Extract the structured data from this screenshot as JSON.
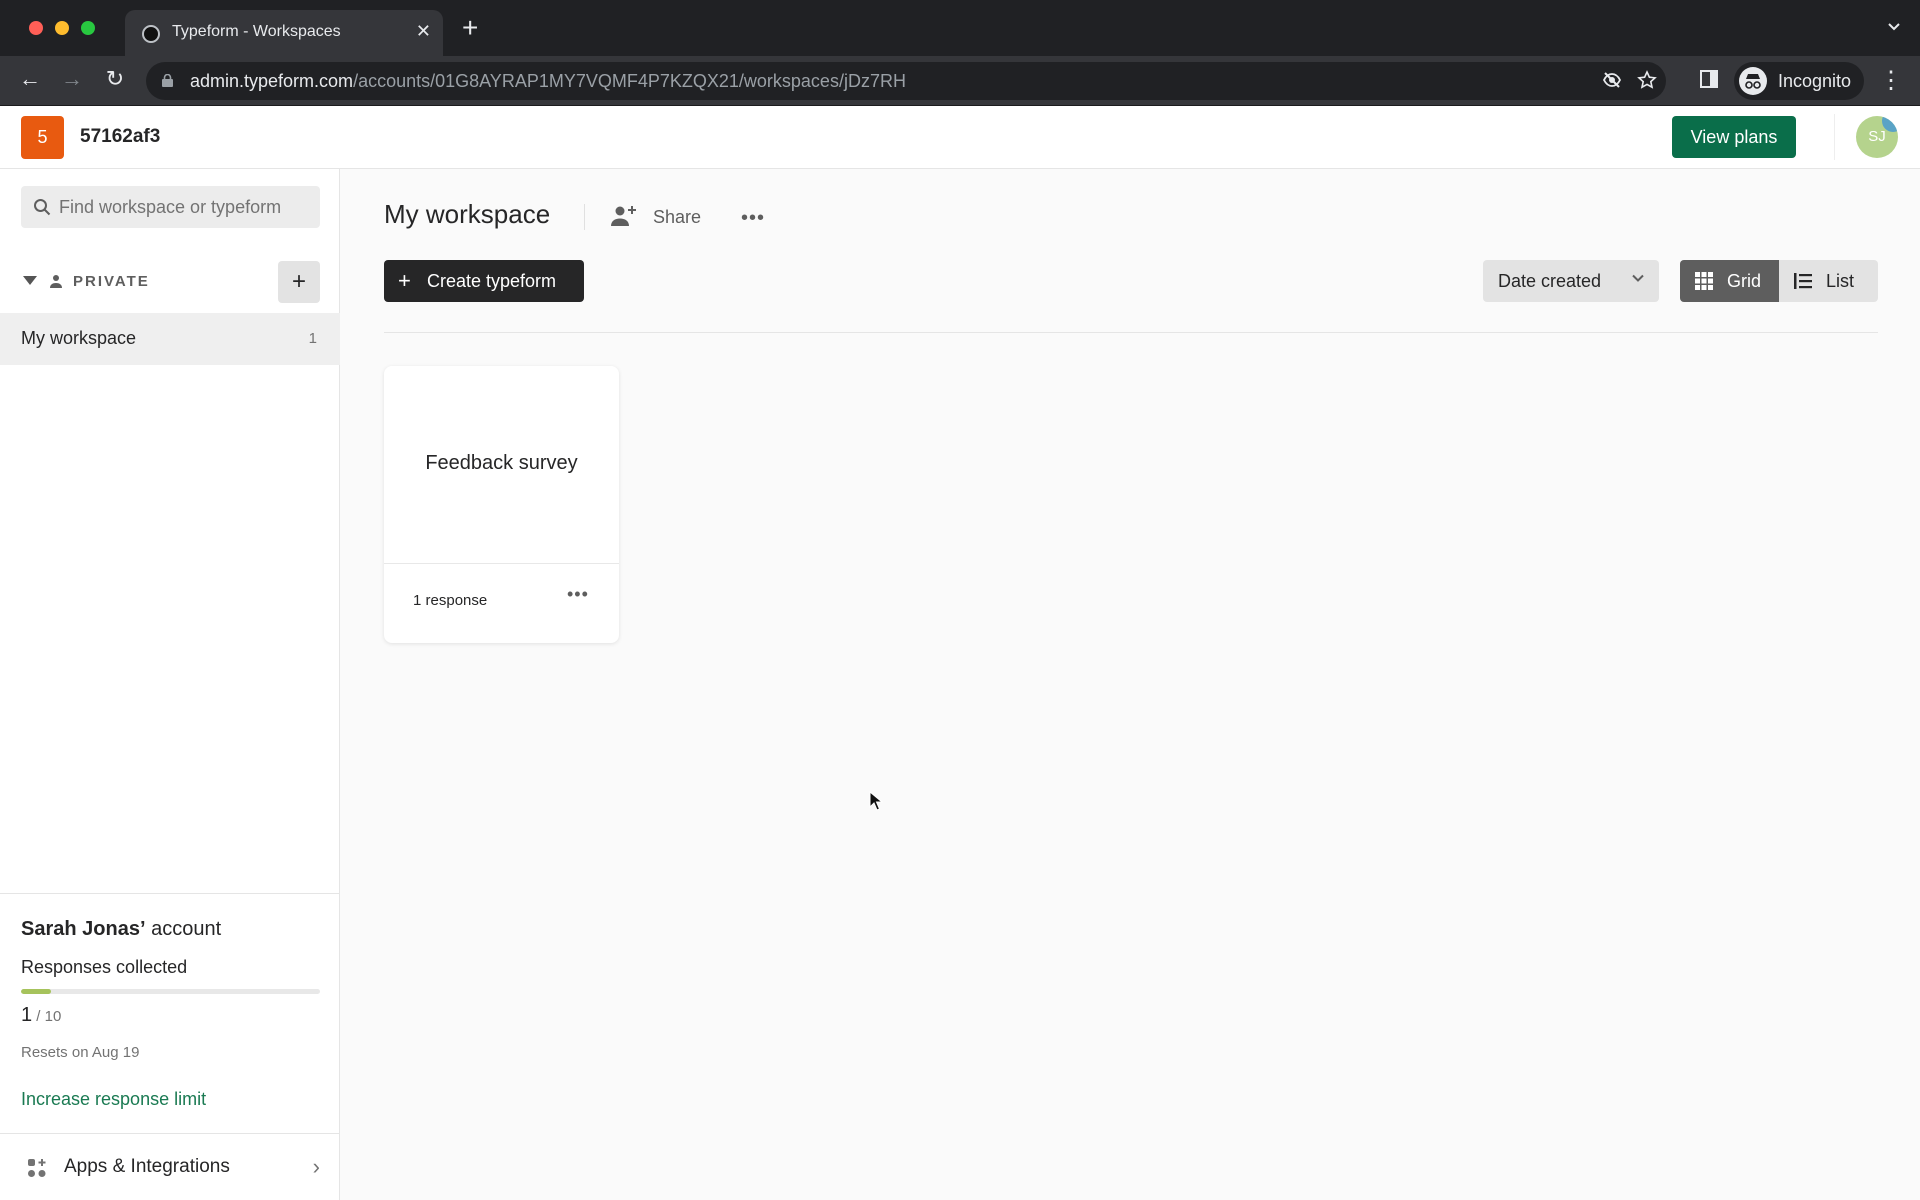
{
  "browser": {
    "tab_title": "Typeform - Workspaces",
    "url_host": "admin.typeform.com",
    "url_path": "/accounts/01G8AYRAP1MY7VQMF4P7KZQX21/workspaces/jDz7RH",
    "profile_label": "Incognito",
    "icons": {
      "back": "←",
      "forward": "→",
      "reload": "↻",
      "close_tab": "✕",
      "new_tab": "+",
      "tab_search": "⌄",
      "menu": "⋮"
    }
  },
  "header": {
    "org_badge": "5",
    "org_name": "57162af3",
    "view_plans_label": "View plans",
    "avatar_initials": "SJ"
  },
  "sidebar": {
    "search_placeholder": "Find workspace or typeform",
    "section_label": "PRIVATE",
    "add_icon": "+",
    "workspaces": [
      {
        "name": "My workspace",
        "count": "1"
      }
    ],
    "account": {
      "owner": "Sarah Jonas’",
      "owner_suffix": " account",
      "responses_label": "Responses collected",
      "responses_used": "1",
      "responses_total": " / 10",
      "responses_fraction": 0.1,
      "reset_text": "Resets on Aug 19",
      "increase_link": "Increase response limit"
    },
    "apps_label": "Apps & Integrations",
    "apps_chevron": "›"
  },
  "main": {
    "title": "My workspace",
    "share_label": "Share",
    "more_icon": "•••",
    "create_plus": "+",
    "create_label": "Create typeform",
    "sort_label": "Date created",
    "view_grid_label": "Grid",
    "view_list_label": "List",
    "colors": {
      "accent_green": "#0a6e4a",
      "progress_fill": "#a6c35c",
      "link_green": "#1a7a52"
    },
    "forms": [
      {
        "title": "Feedback survey",
        "responses": "1 response"
      }
    ]
  }
}
